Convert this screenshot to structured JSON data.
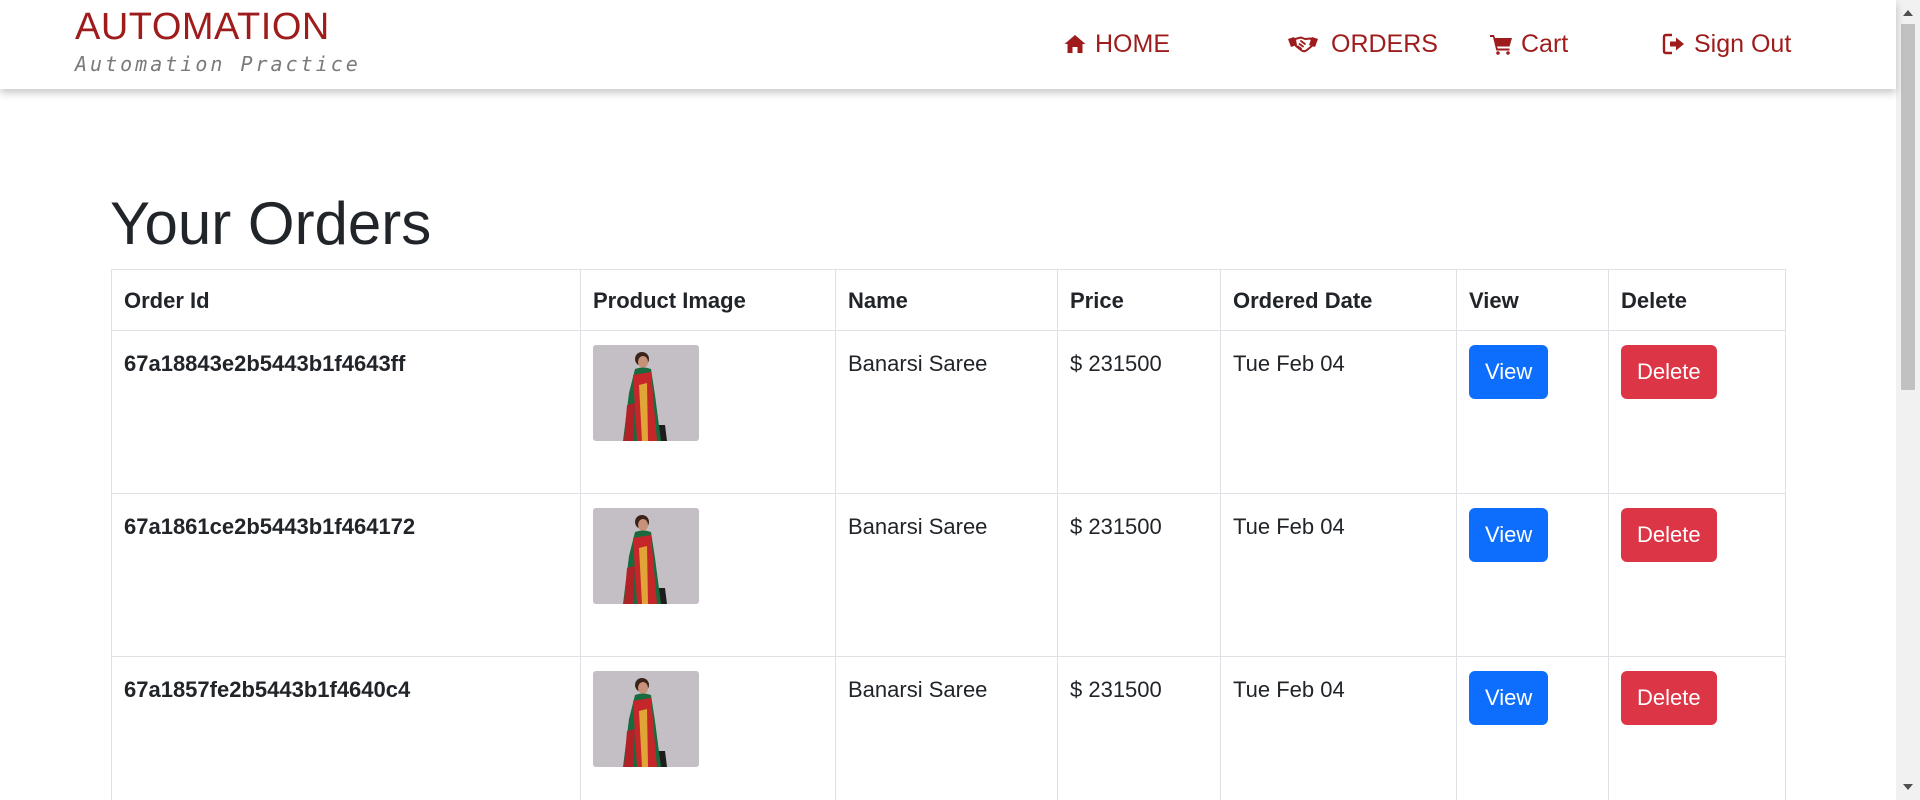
{
  "brand": {
    "title": "AUTOMATION",
    "subtitle": "Automation Practice",
    "color": "#9e1c1c"
  },
  "nav": [
    {
      "label": "HOME",
      "icon": "home-icon"
    },
    {
      "label": "ORDERS",
      "icon": "handshake-icon"
    },
    {
      "label": "Cart",
      "icon": "cart-icon"
    },
    {
      "label": "Sign Out",
      "icon": "sign-out-icon"
    }
  ],
  "main": {
    "title": "Your Orders",
    "table": {
      "headers": [
        "Order Id",
        "Product Image",
        "Name",
        "Price",
        "Ordered Date",
        "View",
        "Delete"
      ],
      "rows": [
        {
          "order_id": "67a18843e2b5443b1f4643ff",
          "name": "Banarsi Saree",
          "price": "$ 231500",
          "date": "Tue Feb 04",
          "view_label": "View",
          "delete_label": "Delete"
        },
        {
          "order_id": "67a1861ce2b5443b1f464172",
          "name": "Banarsi Saree",
          "price": "$ 231500",
          "date": "Tue Feb 04",
          "view_label": "View",
          "delete_label": "Delete"
        },
        {
          "order_id": "67a1857fe2b5443b1f4640c4",
          "name": "Banarsi Saree",
          "price": "$ 231500",
          "date": "Tue Feb 04",
          "view_label": "View",
          "delete_label": "Delete"
        }
      ]
    }
  },
  "colors": {
    "view_button": "#0d6efd",
    "delete_button": "#dc3545"
  }
}
